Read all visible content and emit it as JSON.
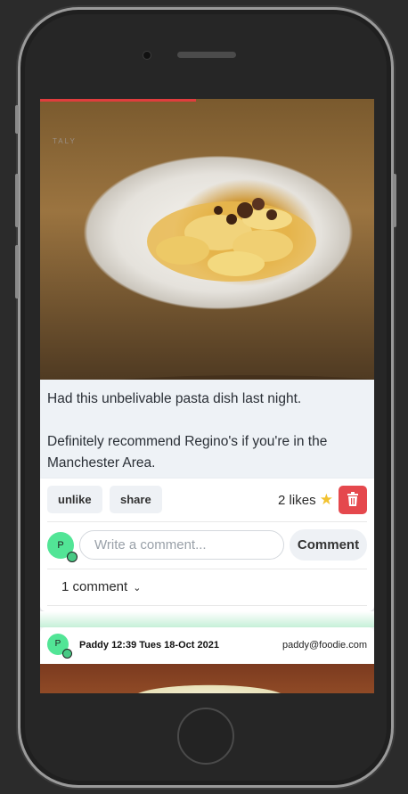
{
  "post": {
    "caption_line1": "Had this unbelivable pasta dish last night.",
    "caption_line2": "Definitely recommend Regino's if you're in the Manchester Area.",
    "plate_text": "TALY",
    "actions": {
      "unlike_label": "unlike",
      "share_label": "share",
      "likes_text": "2 likes",
      "star_icon": "star-icon",
      "delete_icon": "trash-icon"
    },
    "comment_form": {
      "avatar_initial": "P",
      "placeholder": "Write a comment...",
      "submit_label": "Comment"
    },
    "comments_toggle": "1 comment"
  },
  "next_post": {
    "avatar_initial": "P",
    "author_line": "Paddy 12:39 Tues 18-Oct 2021",
    "email": "paddy@foodie.com"
  },
  "colors": {
    "avatar": "#52e596",
    "delete": "#e5484d",
    "accent_bar": "#e03d3d"
  }
}
